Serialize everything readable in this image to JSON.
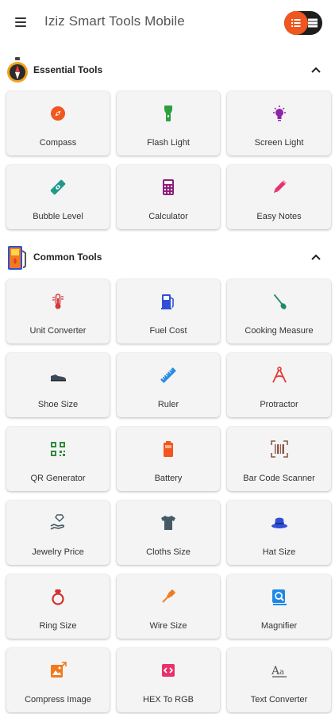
{
  "app": {
    "title": "Iziz Smart Tools Mobile"
  },
  "accent_color": "#f0561e",
  "sections": [
    {
      "title": "Essential Tools",
      "icon": "compass-badge-icon",
      "tools": [
        {
          "label": "Compass",
          "icon": "compass-icon",
          "color": "#f0561e"
        },
        {
          "label": "Flash Light",
          "icon": "flashlight-icon",
          "color": "#2e9e3e"
        },
        {
          "label": "Screen Light",
          "icon": "lightbulb-icon",
          "color": "#8e24aa"
        },
        {
          "label": "Bubble Level",
          "icon": "bubble-level-icon",
          "color": "#1e9a8a"
        },
        {
          "label": "Calculator",
          "icon": "calculator-icon",
          "color": "#8e1f7a"
        },
        {
          "label": "Easy Notes",
          "icon": "pencil-icon",
          "color": "#e8326c"
        }
      ]
    },
    {
      "title": "Common Tools",
      "icon": "fuel-pump-badge-icon",
      "tools": [
        {
          "label": "Unit Converter",
          "icon": "thermometer-icon",
          "color": "#d63a3a"
        },
        {
          "label": "Fuel Cost",
          "icon": "fuel-pump-icon",
          "color": "#2f4fd8"
        },
        {
          "label": "Cooking Measure",
          "icon": "spatula-icon",
          "color": "#1e8a6e"
        },
        {
          "label": "Shoe Size",
          "icon": "shoe-icon",
          "color": "#3a4a5e"
        },
        {
          "label": "Ruler",
          "icon": "ruler-icon",
          "color": "#2a8ae0"
        },
        {
          "label": "Protractor",
          "icon": "protractor-icon",
          "color": "#e53935"
        },
        {
          "label": "QR Generator",
          "icon": "qr-code-icon",
          "color": "#2e8b3e"
        },
        {
          "label": "Battery",
          "icon": "battery-icon",
          "color": "#f0561e"
        },
        {
          "label": "Bar Code Scanner",
          "icon": "barcode-scanner-icon",
          "color": "#8a5a4a"
        },
        {
          "label": "Jewelry Price",
          "icon": "jewelry-hand-icon",
          "color": "#455a64"
        },
        {
          "label": "Cloths Size",
          "icon": "tshirt-icon",
          "color": "#455a64"
        },
        {
          "label": "Hat Size",
          "icon": "hat-icon",
          "color": "#2f4fd8"
        },
        {
          "label": "Ring Size",
          "icon": "ring-icon",
          "color": "#d32f2f"
        },
        {
          "label": "Wire Size",
          "icon": "wire-plug-icon",
          "color": "#f07b1e"
        },
        {
          "label": "Magnifier",
          "icon": "magnifier-icon",
          "color": "#1e88e5"
        },
        {
          "label": "Compress Image",
          "icon": "compress-image-icon",
          "color": "#f07b1e"
        },
        {
          "label": "HEX To RGB",
          "icon": "hex-code-icon",
          "color": "#e8326c"
        },
        {
          "label": "Text Converter",
          "icon": "text-converter-icon",
          "color": "#555555"
        }
      ]
    }
  ]
}
